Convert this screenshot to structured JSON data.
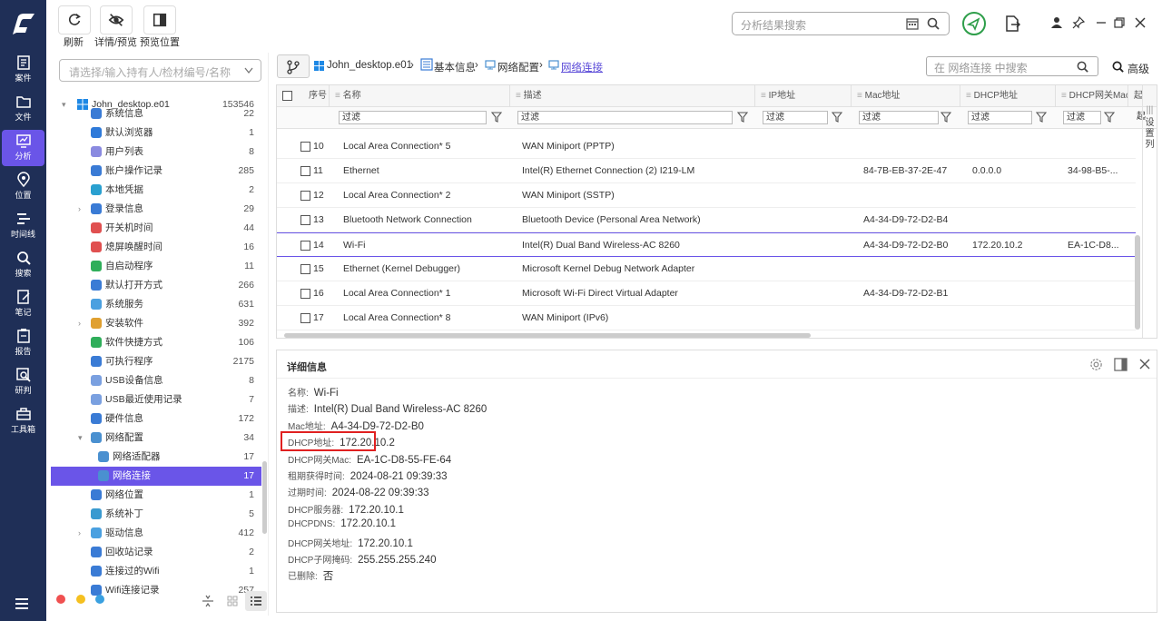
{
  "sidebar": {
    "items": [
      {
        "label": "案件",
        "icon": "case-icon"
      },
      {
        "label": "文件",
        "icon": "folder-icon"
      },
      {
        "label": "分析",
        "icon": "analysis-icon",
        "active": true
      },
      {
        "label": "位置",
        "icon": "location-icon"
      },
      {
        "label": "时间线",
        "icon": "timeline-icon"
      },
      {
        "label": "搜索",
        "icon": "search-icon"
      },
      {
        "label": "笔记",
        "icon": "note-icon"
      },
      {
        "label": "报告",
        "icon": "report-icon"
      },
      {
        "label": "研判",
        "icon": "judge-icon"
      },
      {
        "label": "工具箱",
        "icon": "toolbox-icon"
      }
    ]
  },
  "toolbar": {
    "refresh_label": "刷新",
    "preview_label": "详情/预览",
    "position_label": "预览位置",
    "search_placeholder": "分析结果搜索"
  },
  "left": {
    "search_placeholder": "请选择/输入持有人/检材编号/名称",
    "root": {
      "label": "John_desktop.e01",
      "count": "153546"
    },
    "items": [
      {
        "label": "系统信息",
        "count": "22",
        "indent": 1,
        "color": "#3a7bd5",
        "arrow": false
      },
      {
        "label": "默认浏览器",
        "count": "1",
        "indent": 1,
        "color": "#2f7ad9",
        "arrow": false
      },
      {
        "label": "用户列表",
        "count": "8",
        "indent": 1,
        "color": "#8a8ae0",
        "arrow": false
      },
      {
        "label": "账户操作记录",
        "count": "285",
        "indent": 1,
        "color": "#3a7bd5",
        "arrow": false
      },
      {
        "label": "本地凭据",
        "count": "2",
        "indent": 1,
        "color": "#2aa0d0",
        "arrow": false
      },
      {
        "label": "登录信息",
        "count": "29",
        "indent": 1,
        "color": "#3a7bd5",
        "arrow": true
      },
      {
        "label": "开关机时间",
        "count": "44",
        "indent": 1,
        "color": "#e05050",
        "arrow": false
      },
      {
        "label": "熄屏唤醒时间",
        "count": "16",
        "indent": 1,
        "color": "#e05050",
        "arrow": false
      },
      {
        "label": "自启动程序",
        "count": "11",
        "indent": 1,
        "color": "#2fae5a",
        "arrow": false
      },
      {
        "label": "默认打开方式",
        "count": "266",
        "indent": 1,
        "color": "#3a7bd5",
        "arrow": false
      },
      {
        "label": "系统服务",
        "count": "631",
        "indent": 1,
        "color": "#4aa0e0",
        "arrow": false
      },
      {
        "label": "安装软件",
        "count": "392",
        "indent": 1,
        "color": "#e0a030",
        "arrow": true
      },
      {
        "label": "软件快捷方式",
        "count": "106",
        "indent": 1,
        "color": "#2fae5a",
        "arrow": false
      },
      {
        "label": "可执行程序",
        "count": "2175",
        "indent": 1,
        "color": "#3a7bd5",
        "arrow": false
      },
      {
        "label": "USB设备信息",
        "count": "8",
        "indent": 1,
        "color": "#7aa0e0",
        "arrow": false
      },
      {
        "label": "USB最近使用记录",
        "count": "7",
        "indent": 1,
        "color": "#7aa0e0",
        "arrow": false
      },
      {
        "label": "硬件信息",
        "count": "172",
        "indent": 1,
        "color": "#3a7bd5",
        "arrow": false
      },
      {
        "label": "网络配置",
        "count": "34",
        "indent": 1,
        "color": "#4a90d0",
        "arrow": true,
        "open": true
      },
      {
        "label": "网络适配器",
        "count": "17",
        "indent": 2,
        "color": "#4a90d0",
        "arrow": false
      },
      {
        "label": "网络连接",
        "count": "17",
        "indent": 2,
        "color": "#4a90d0",
        "arrow": false,
        "selected": true
      },
      {
        "label": "网络位置",
        "count": "1",
        "indent": 1,
        "color": "#3a7bd5",
        "arrow": false
      },
      {
        "label": "系统补丁",
        "count": "5",
        "indent": 1,
        "color": "#3a9ad0",
        "arrow": false
      },
      {
        "label": "驱动信息",
        "count": "412",
        "indent": 1,
        "color": "#4aa0e0",
        "arrow": true
      },
      {
        "label": "回收站记录",
        "count": "2",
        "indent": 1,
        "color": "#3a7bd5",
        "arrow": false
      },
      {
        "label": "连接过的Wifi",
        "count": "1",
        "indent": 1,
        "color": "#3a7bd5",
        "arrow": false
      },
      {
        "label": "Wifi连接记录",
        "count": "257",
        "indent": 1,
        "color": "#3a7bd5",
        "arrow": false
      }
    ]
  },
  "breadcrumb": {
    "root": "John_desktop.e01",
    "b1": "基本信息",
    "b2": "网络配置",
    "b3": "网络连接",
    "search_placeholder": "在 网络连接 中搜索",
    "advanced": "高级"
  },
  "grid": {
    "headers": [
      "序号",
      "名称",
      "描述",
      "IP地址",
      "Mac地址",
      "DHCP地址",
      "DHCP网关Mac",
      "起"
    ],
    "filter": "过滤",
    "setcol": "设置列",
    "rows": [
      {
        "no": "10",
        "name": "Local Area Connection* 5",
        "desc": "WAN Miniport (PPTP)",
        "ip": "",
        "mac": "",
        "dhcp": "",
        "gwmac": ""
      },
      {
        "no": "11",
        "name": "Ethernet",
        "desc": "Intel(R) Ethernet Connection (2) I219-LM",
        "ip": "",
        "mac": "84-7B-EB-37-2E-47",
        "dhcp": "0.0.0.0",
        "gwmac": "34-98-B5-..."
      },
      {
        "no": "12",
        "name": "Local Area Connection* 2",
        "desc": "WAN Miniport (SSTP)",
        "ip": "",
        "mac": "",
        "dhcp": "",
        "gwmac": ""
      },
      {
        "no": "13",
        "name": "Bluetooth Network Connection",
        "desc": "Bluetooth Device (Personal Area Network)",
        "ip": "",
        "mac": "A4-34-D9-72-D2-B4",
        "dhcp": "",
        "gwmac": ""
      },
      {
        "no": "14",
        "name": "Wi-Fi",
        "desc": "Intel(R) Dual Band Wireless-AC 8260",
        "ip": "",
        "mac": "A4-34-D9-72-D2-B0",
        "dhcp": "172.20.10.2",
        "gwmac": "EA-1C-D8...",
        "selected": true
      },
      {
        "no": "15",
        "name": "Ethernet (Kernel Debugger)",
        "desc": "Microsoft Kernel Debug Network Adapter",
        "ip": "",
        "mac": "",
        "dhcp": "",
        "gwmac": ""
      },
      {
        "no": "16",
        "name": "Local Area Connection* 1",
        "desc": "Microsoft Wi-Fi Direct Virtual Adapter",
        "ip": "",
        "mac": "A4-34-D9-72-D2-B1",
        "dhcp": "",
        "gwmac": ""
      },
      {
        "no": "17",
        "name": "Local Area Connection* 8",
        "desc": "WAN Miniport (IPv6)",
        "ip": "",
        "mac": "",
        "dhcp": "",
        "gwmac": ""
      }
    ]
  },
  "detail": {
    "title": "详细信息",
    "fields": [
      {
        "k": "名称:",
        "v": "Wi-Fi"
      },
      {
        "k": "描述:",
        "v": "Intel(R) Dual Band Wireless-AC 8260"
      },
      {
        "k": "Mac地址:",
        "v": "A4-34-D9-72-D2-B0"
      },
      {
        "k": "DHCP地址:",
        "v": "172.20.10.2"
      },
      {
        "k": "DHCP网关Mac:",
        "v": "EA-1C-D8-55-FE-64"
      },
      {
        "k": "租期获得时间:",
        "v": "2024-08-21 09:39:33"
      },
      {
        "k": "过期时间:",
        "v": "2024-08-22 09:39:33"
      },
      {
        "k": "DHCP服务器:",
        "v": "172.20.10.1"
      },
      {
        "k": "DHCPDNS:",
        "v": "172.20.10.1"
      },
      {
        "k": "DHCP网关地址:",
        "v": "172.20.10.1"
      },
      {
        "k": "DHCP子网掩码:",
        "v": "255.255.255.240"
      },
      {
        "k": "已删除:",
        "v": "否"
      }
    ]
  },
  "colors": {
    "sidebar": "#1f2f57",
    "accent": "#6a55e8",
    "highlight": "#e02020"
  }
}
